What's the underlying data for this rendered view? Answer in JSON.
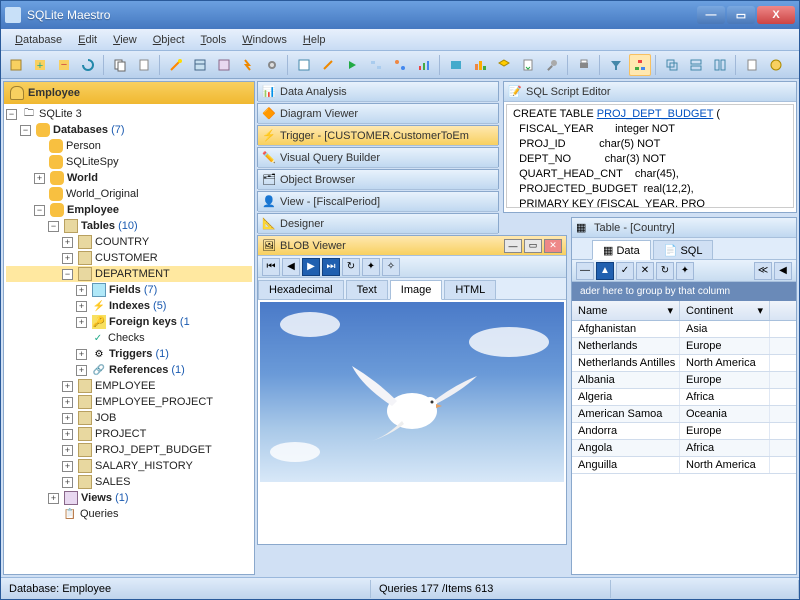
{
  "window": {
    "title": "SQLite Maestro"
  },
  "menu": [
    "Database",
    "Edit",
    "View",
    "Object",
    "Tools",
    "Windows",
    "Help"
  ],
  "sidebar": {
    "header": "Employee"
  },
  "tree": {
    "root": "SQLite 3",
    "databases": {
      "label": "Databases",
      "count": "(7)"
    },
    "dbs": [
      "Person",
      "SQLiteSpy",
      "World",
      "World_Original",
      "Employee"
    ],
    "tables": {
      "label": "Tables",
      "count": "(10)"
    },
    "tablelist": [
      "COUNTRY",
      "CUSTOMER",
      "DEPARTMENT",
      "EMPLOYEE",
      "EMPLOYEE_PROJECT",
      "JOB",
      "PROJECT",
      "PROJ_DEPT_BUDGET",
      "SALARY_HISTORY",
      "SALES"
    ],
    "dept": {
      "fields": {
        "label": "Fields",
        "count": "(7)"
      },
      "indexes": {
        "label": "Indexes",
        "count": "(5)"
      },
      "fkeys": {
        "label": "Foreign keys",
        "count": "(1"
      },
      "checks": "Checks",
      "triggers": {
        "label": "Triggers",
        "count": "(1)"
      },
      "refs": {
        "label": "References",
        "count": "(1)"
      }
    },
    "views": {
      "label": "Views",
      "count": "(1)"
    },
    "queries": "Queries"
  },
  "panels": {
    "analysis": "Data Analysis",
    "diagram": "Diagram Viewer",
    "trigger": "Trigger - [CUSTOMER.CustomerToEm",
    "vqb": "Visual Query Builder",
    "browser": "Object Browser",
    "view": "View - [FiscalPeriod]",
    "designer": "Designer",
    "sql": "SQL Script Editor",
    "blob": "BLOB Viewer",
    "table": "Table - [Country]"
  },
  "sqltext": {
    "l1a": "CREATE TABLE ",
    "l1b": "PROJ_DEPT_BUDGET",
    "l1c": " (",
    "l2": "  FISCAL_YEAR       integer NOT",
    "l3": "  PROJ_ID           char(5) NOT",
    "l4": "  DEPT_NO           char(3) NOT",
    "l5": "  QUART_HEAD_CNT    char(45),",
    "l6": "  PROJECTED_BUDGET  real(12,2),",
    "l7": "  PRIMARY KEY (FISCAL_YEAR, PRO",
    "l8": ");"
  },
  "blobTabs": [
    "Hexadecimal",
    "Text",
    "Image",
    "HTML"
  ],
  "tableTabs": [
    "Data",
    "SQL"
  ],
  "groupHint": "ader here to group by that column",
  "gridCols": [
    "Name",
    "Continent"
  ],
  "gridData": [
    [
      "Afghanistan",
      "Asia"
    ],
    [
      "Netherlands",
      "Europe"
    ],
    [
      "Netherlands Antilles",
      "North America"
    ],
    [
      "Albania",
      "Europe"
    ],
    [
      "Algeria",
      "Africa"
    ],
    [
      "American Samoa",
      "Oceania"
    ],
    [
      "Andorra",
      "Europe"
    ],
    [
      "Angola",
      "Africa"
    ],
    [
      "Anguilla",
      "North America"
    ]
  ],
  "status": {
    "db": "Database: Employee",
    "items": "Queries 177 /Items 613"
  }
}
